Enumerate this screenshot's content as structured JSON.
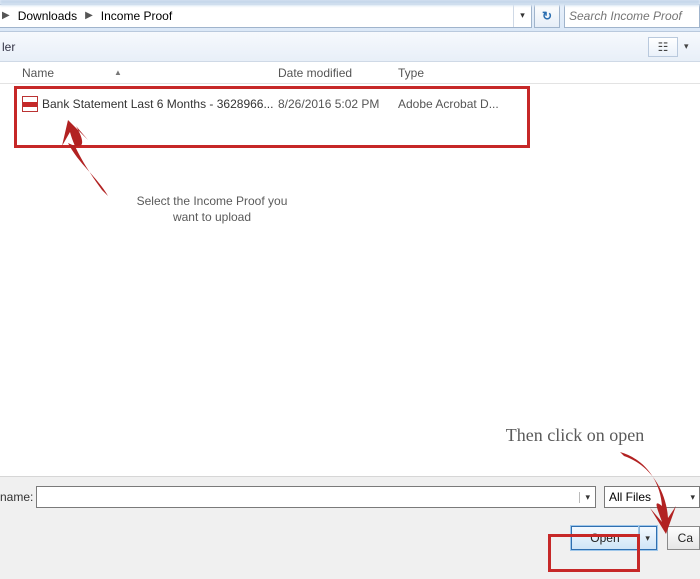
{
  "breadcrumbs": {
    "seg1": "Downloads",
    "seg2": "Income Proof"
  },
  "search": {
    "placeholder": "Search Income Proof"
  },
  "toolbar": {
    "left_fragment": "ler"
  },
  "columns": {
    "name": "Name",
    "date": "Date modified",
    "type": "Type"
  },
  "files": [
    {
      "name": "Bank Statement Last 6 Months - 3628966...",
      "date": "8/26/2016 5:02 PM",
      "type": "Adobe Acrobat D..."
    }
  ],
  "annotations": {
    "select_line1": "Select the Income Proof you",
    "select_line2": "want to upload",
    "open": "Then click on open"
  },
  "bottom": {
    "name_label": "name:",
    "filter": "All Files",
    "open_btn": "Open",
    "cancel_btn_fragment": "Ca"
  }
}
